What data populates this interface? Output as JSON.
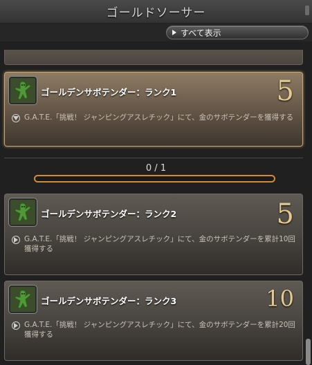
{
  "window": {
    "title": "ゴールドソーサー"
  },
  "toolbar": {
    "show_all_label": "すべて表示"
  },
  "progress": {
    "text": "0 / 1",
    "fraction": 0
  },
  "achievements": [
    {
      "name": "ゴールデンサボテンダー：ランク1",
      "points": "5",
      "description": "G.A.T.E.「挑戦！ ジャンピングアスレチック」にて、金のサボテンダーを獲得する",
      "icon": "cactuar-icon",
      "state": "selected"
    },
    {
      "name": "ゴールデンサボテンダー：ランク2",
      "points": "5",
      "description": "G.A.T.E.「挑戦！ ジャンピングアスレチック」にて、金のサボテンダーを累計10回獲得する",
      "icon": "cactuar-icon",
      "state": "collapsed"
    },
    {
      "name": "ゴールデンサボテンダー：ランク3",
      "points": "10",
      "description": "G.A.T.E.「挑戦！ ジャンピングアスレチック」にて、金のサボテンダーを累計20回獲得する",
      "icon": "cactuar-icon",
      "state": "collapsed"
    }
  ],
  "colors": {
    "accent_orange": "#d98a2a",
    "points_gold": "#e3c98d",
    "selected_border": "#c8a778"
  }
}
